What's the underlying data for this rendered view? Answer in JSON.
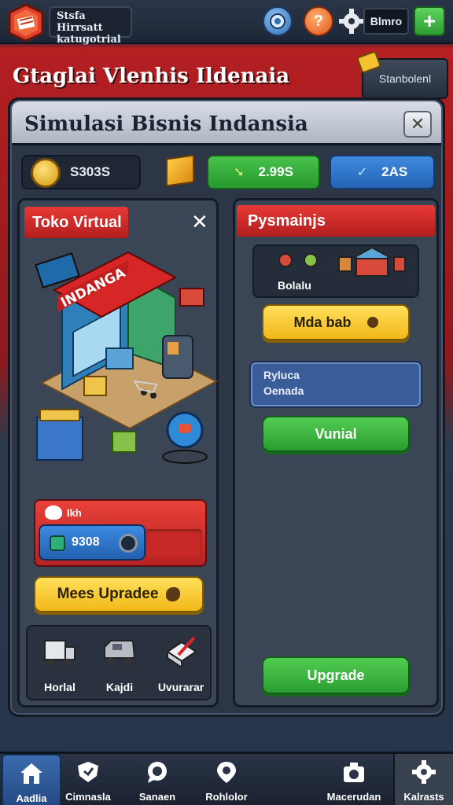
{
  "topbar": {
    "brand_line1": "Stsfa Hirrsatt",
    "brand_line2": "katugotrial",
    "help_glyph": "?",
    "money_label": "Blmro",
    "plus_glyph": "+"
  },
  "banner": {
    "title": "Gtaglai Vlenhis Ildenaia",
    "side_tab": "Stanbolenl"
  },
  "panel": {
    "title": "Simulasi Bisnis Indansia",
    "close_glyph": "✕",
    "stats": {
      "coins": "S303S",
      "green": "2.99S",
      "blue": "2AS"
    }
  },
  "left_card": {
    "title": "Toko Virtual",
    "close_glyph": "✕",
    "shop_sign": "INDANGA",
    "progress_label": "Ikh",
    "progress_value": "9308",
    "upgrade_button": "Mees Upradee",
    "vehicles": [
      {
        "label": "Horlal"
      },
      {
        "label": "Kajdi"
      },
      {
        "label": "Uvurarar"
      }
    ]
  },
  "right_card": {
    "title": "Pysmainjs",
    "feature_label": "Bolalu",
    "maba_button": "Mda bab",
    "info_line1": "Ryluca",
    "info_line2": "Oenada",
    "vunial_button": "Vunial",
    "upgrade_button": "Upgrade"
  },
  "bottom_nav": [
    {
      "label": "Aadlia",
      "icon": "home-icon"
    },
    {
      "label": "Cimnasla",
      "icon": "shield-icon"
    },
    {
      "label": "Sanaen",
      "icon": "chat-icon"
    },
    {
      "label": "Rohlolor",
      "icon": "location-icon"
    },
    {
      "label": "Macerudan",
      "icon": "camera-icon"
    },
    {
      "label": "Kalrasts",
      "icon": "gear-icon"
    }
  ],
  "colors": {
    "accent_red": "#d42a28",
    "button_green": "#2a9e30",
    "button_yellow": "#f2b81a",
    "stat_blue": "#2462b4"
  }
}
